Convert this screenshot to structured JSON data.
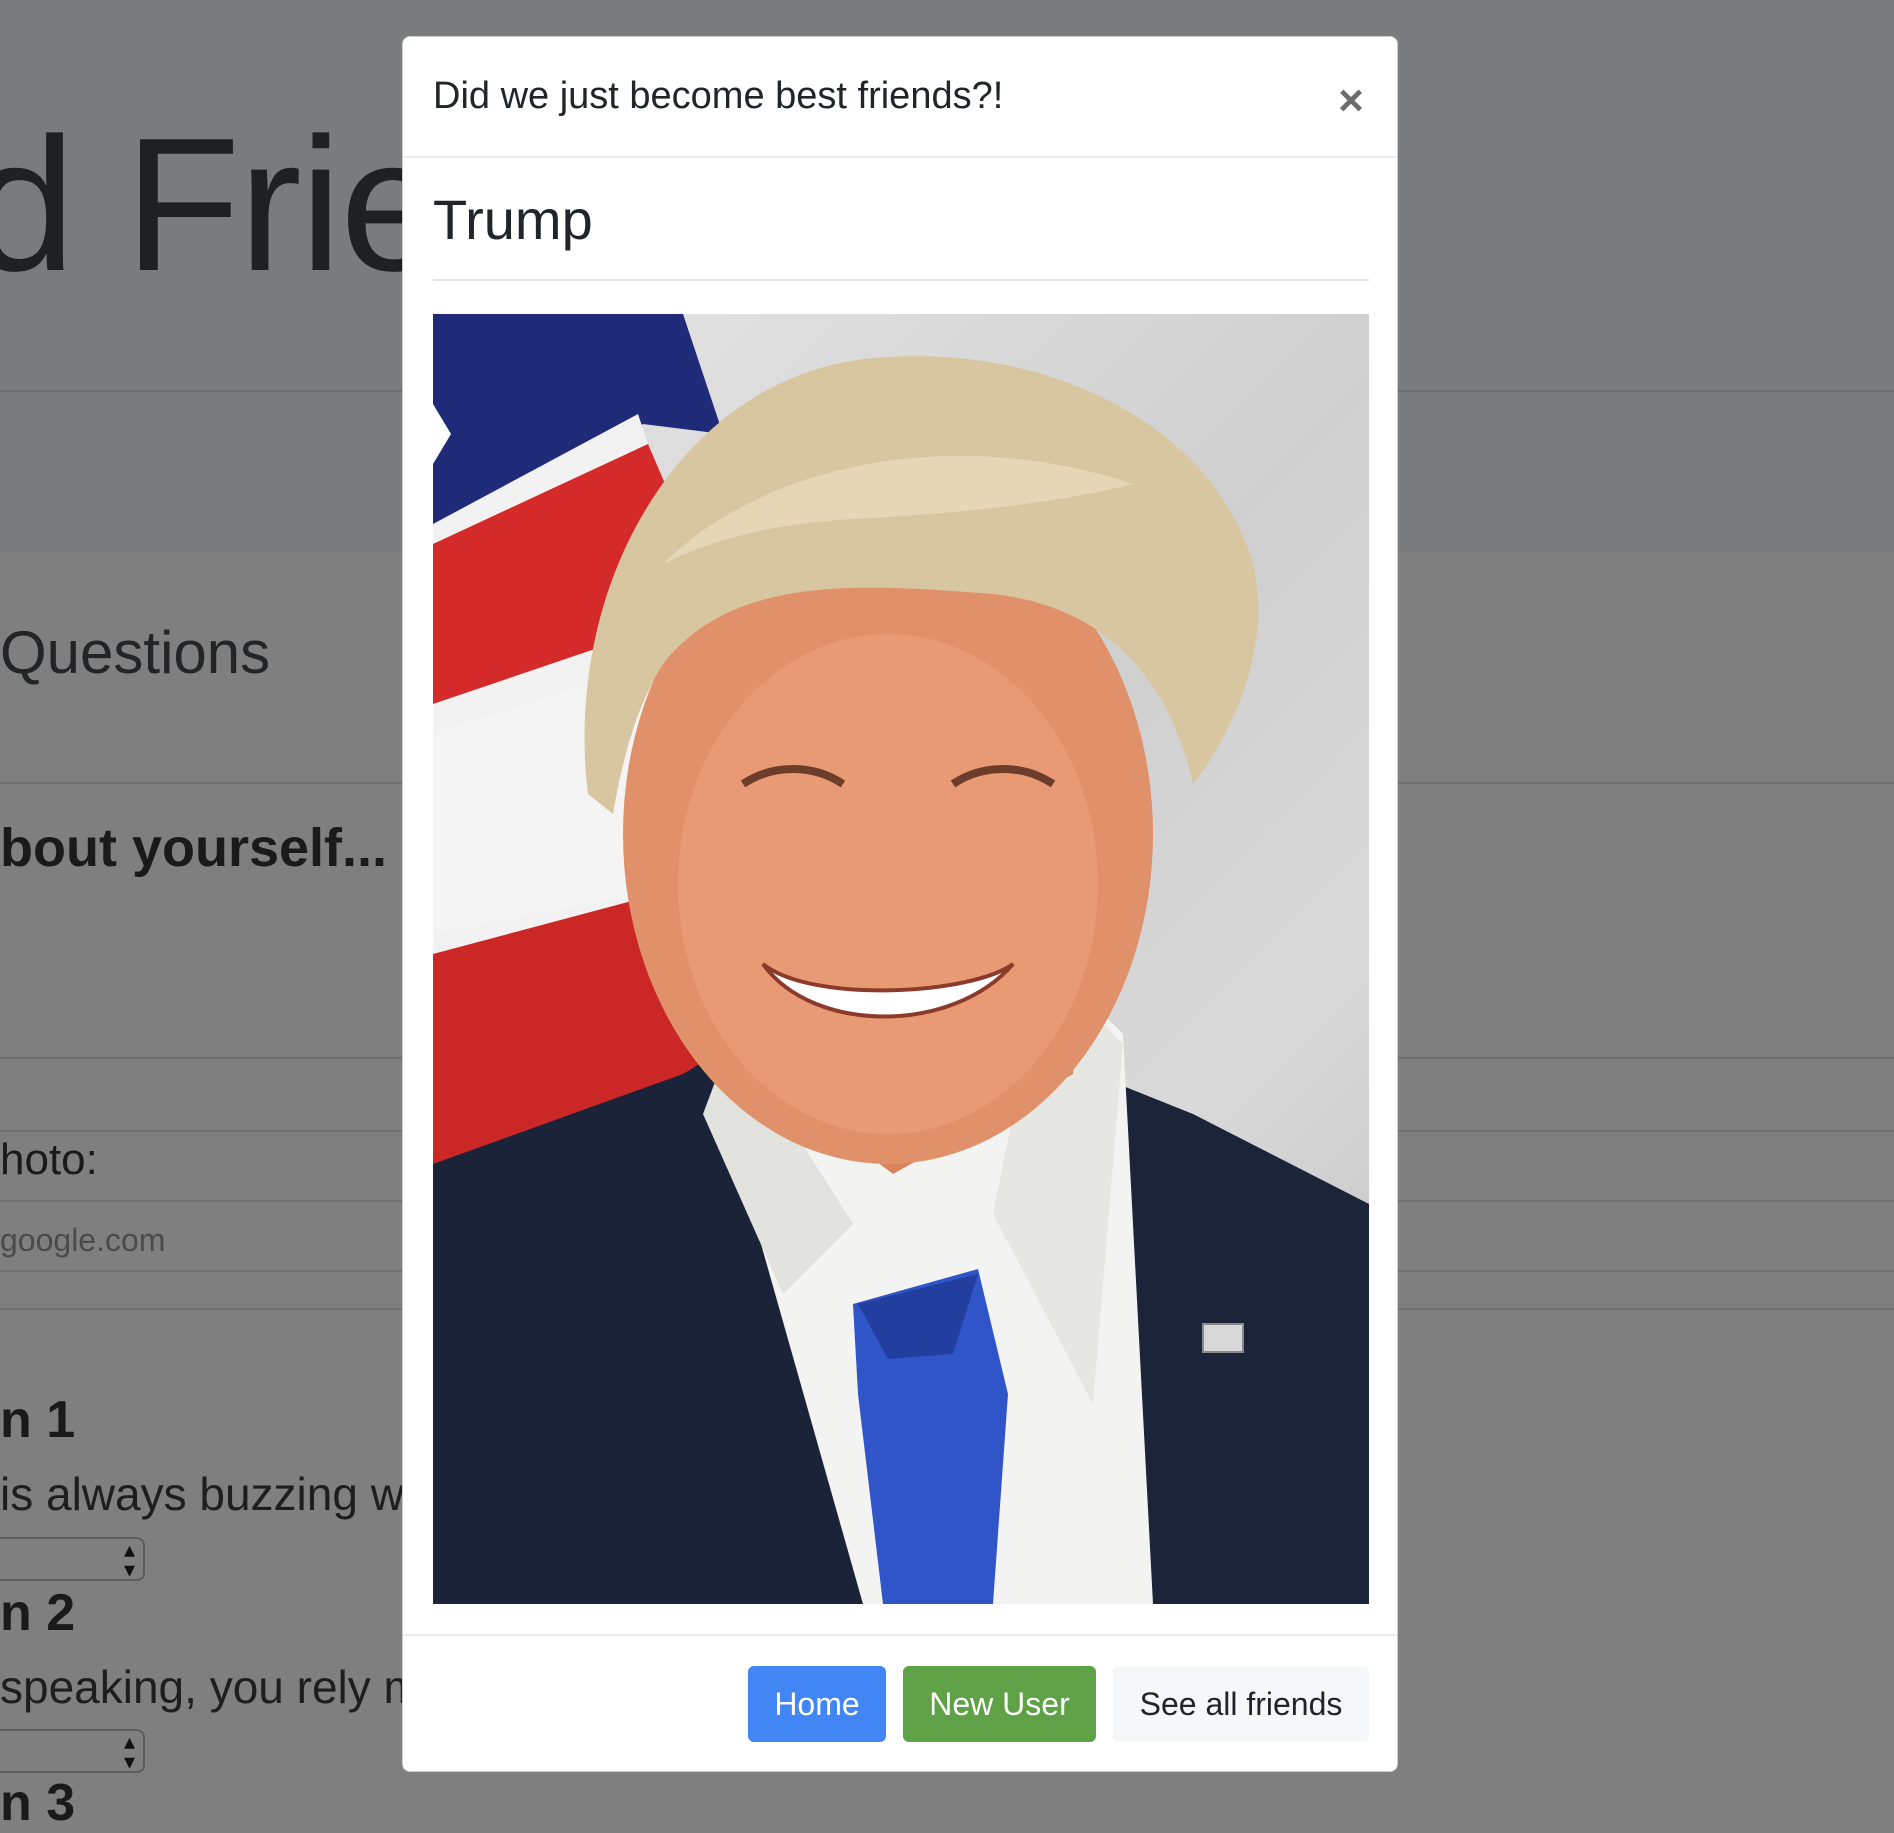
{
  "background": {
    "jumbotron_title": "d Frien",
    "section_title": "Questions",
    "about_heading": "bout yourself...",
    "photo_label": "hoto:",
    "photo_placeholder": "google.com",
    "questions": [
      {
        "title": "n 1",
        "text": "is always buzzing w"
      },
      {
        "title": "n 2",
        "text": "speaking, you rely m"
      },
      {
        "title": "n 3"
      }
    ]
  },
  "modal": {
    "title": "Did we just become best friends?!",
    "close_symbol": "×",
    "friend_name": "Trump",
    "photo_subject": "portrait-photo",
    "buttons": {
      "home": "Home",
      "new_user": "New User",
      "see_all": "See all friends"
    }
  },
  "colors": {
    "home_button": "#4285f4",
    "new_user_button": "#5ea146",
    "see_all_button": "#f6f7f8",
    "backdrop": "#7f7f7f"
  }
}
